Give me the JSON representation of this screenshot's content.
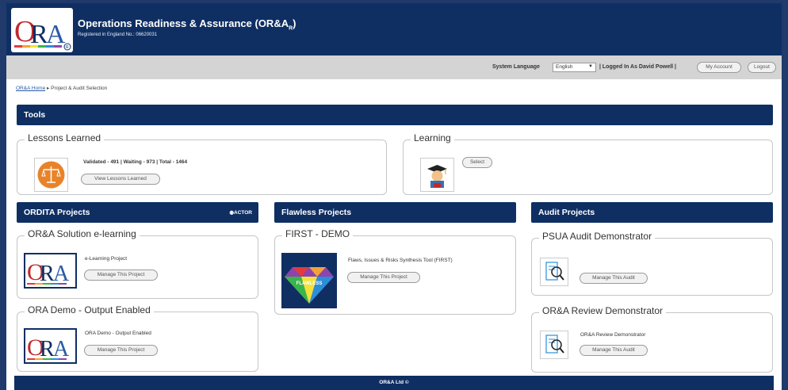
{
  "header": {
    "title": "Operations Readiness & Assurance (OR&A",
    "title_sub": "R",
    "title_end": ")",
    "registration": "Registered in England No.: 06620031",
    "logo_text": "ORA"
  },
  "userbar": {
    "language_label": "System Language",
    "language_value": "English",
    "logged_in": "| Logged In As David Powell |",
    "my_account": "My Account",
    "logout": "Logout"
  },
  "breadcrumb": {
    "home": "OR&A Home",
    "separator": "▸",
    "current": "Project & Audit Selection"
  },
  "tools": {
    "title": "Tools",
    "lessons": {
      "title": "Lessons Learned",
      "stats": "Validated - 491 | Waiting - 973 | Total - 1464",
      "button": "View Lessons Learned"
    },
    "learning": {
      "title": "Learning",
      "button": "Select"
    }
  },
  "ordita": {
    "title": "ORDITA Projects",
    "actor": "◉ACTOR",
    "projects": [
      {
        "title": "OR&A Solution e-learning",
        "desc": "e-Learning Project",
        "button": "Manage This Project"
      },
      {
        "title": "ORA Demo - Output Enabled",
        "desc": "ORA Demo - Output Enabled",
        "button": "Manage This Project"
      }
    ]
  },
  "flawless": {
    "title": "Flawless Projects",
    "projects": [
      {
        "title": "FIRST - DEMO",
        "desc": "Flaws, Issues & Risks Synthesis Tool (FIRST)",
        "button": "Manage This Project",
        "thumb_text": "FLAWLESS"
      }
    ]
  },
  "audit": {
    "title": "Audit Projects",
    "projects": [
      {
        "title": "PSUA Audit Demonstrator",
        "desc": "",
        "button": "Manage This Audit"
      },
      {
        "title": "OR&A Review Demonstrator",
        "desc": "OR&A Review Demonstrator",
        "button": "Manage This Audit"
      }
    ]
  },
  "footer": {
    "text": "OR&A Ltd ©"
  },
  "colors": {
    "navy": "#0f2f63",
    "outer_border": "#1f3a6b",
    "userbar": "#d4d4d4",
    "orange": "#e8832a"
  }
}
